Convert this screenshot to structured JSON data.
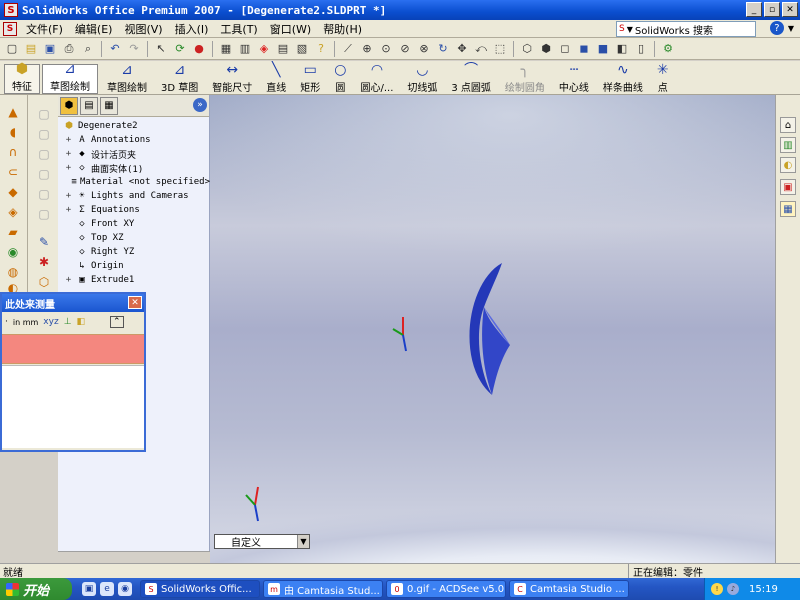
{
  "window": {
    "title": "SolidWorks Office Premium 2007 - [Degenerate2.SLDPRT *]",
    "app_icon_text": "S"
  },
  "menu": {
    "items": [
      {
        "label": "文件(F)",
        "disabled": false
      },
      {
        "label": "编辑(E)",
        "disabled": false
      },
      {
        "label": "视图(V)",
        "disabled": false
      },
      {
        "label": "插入(I)",
        "disabled": false
      },
      {
        "label": "工具(T)",
        "disabled": false
      },
      {
        "label": "窗口(W)",
        "disabled": false
      },
      {
        "label": "帮助(H)",
        "disabled": false
      }
    ],
    "search_label": "SolidWorks 搜索"
  },
  "commandmanager": {
    "tabs": [
      {
        "label": "特征",
        "icon": "feature-icon"
      },
      {
        "label": "草图绘制",
        "icon": "sketch-tab-icon"
      }
    ],
    "commands": [
      {
        "label": "草图绘制",
        "icon": "sketch-icon",
        "glyph": "⊿",
        "disabled": false
      },
      {
        "label": "3D 草图",
        "icon": "3d-sketch-icon",
        "glyph": "⊿",
        "disabled": false
      },
      {
        "label": "智能尺寸",
        "icon": "smart-dimension-icon",
        "glyph": "↔",
        "disabled": false
      },
      {
        "label": "直线",
        "icon": "line-icon",
        "glyph": "╲",
        "disabled": false
      },
      {
        "label": "矩形",
        "icon": "rectangle-icon",
        "glyph": "▭",
        "disabled": false
      },
      {
        "label": "圆",
        "icon": "circle-icon",
        "glyph": "○",
        "disabled": false
      },
      {
        "label": "圆心/...",
        "icon": "centerpoint-arc-icon",
        "glyph": "◠",
        "disabled": false
      },
      {
        "label": "切线弧",
        "icon": "tangent-arc-icon",
        "glyph": "◡",
        "disabled": false
      },
      {
        "label": "3 点圆弧",
        "icon": "3point-arc-icon",
        "glyph": "⌒",
        "disabled": false
      },
      {
        "label": "绘制圆角",
        "icon": "sketch-fillet-icon",
        "glyph": "╮",
        "disabled": true
      },
      {
        "label": "中心线",
        "icon": "centerline-icon",
        "glyph": "┄",
        "disabled": false
      },
      {
        "label": "样条曲线",
        "icon": "spline-icon",
        "glyph": "∿",
        "disabled": false
      },
      {
        "label": "点",
        "icon": "point-icon",
        "glyph": "✳",
        "disabled": false
      }
    ]
  },
  "feature_tree": {
    "root": "Degenerate2",
    "items": [
      {
        "label": "Annotations",
        "icon": "annotations-icon",
        "glyph": "A",
        "expandable": true
      },
      {
        "label": "设计活页夹",
        "icon": "design-binder-icon",
        "glyph": "◆",
        "expandable": true
      },
      {
        "label": "曲面实体(1)",
        "icon": "surface-bodies-icon",
        "glyph": "◇",
        "expandable": true
      },
      {
        "label": "Material <not specified>",
        "icon": "material-icon",
        "glyph": "≡",
        "expandable": false
      },
      {
        "label": "Lights and Cameras",
        "icon": "lights-icon",
        "glyph": "☀",
        "expandable": true
      },
      {
        "label": "Equations",
        "icon": "equations-icon",
        "glyph": "Σ",
        "expandable": true
      },
      {
        "label": "Front XY",
        "icon": "plane-icon",
        "glyph": "◇",
        "expandable": false
      },
      {
        "label": "Top XZ",
        "icon": "plane-icon",
        "glyph": "◇",
        "expandable": false
      },
      {
        "label": "Right YZ",
        "icon": "plane-icon",
        "glyph": "◇",
        "expandable": false
      },
      {
        "label": "Origin",
        "icon": "origin-icon",
        "glyph": "↳",
        "expandable": false
      },
      {
        "label": "Extrude1",
        "icon": "extrude-icon",
        "glyph": "▣",
        "expandable": true
      }
    ]
  },
  "measure": {
    "title": "此处来测量",
    "units_label": "in mm"
  },
  "viewport": {
    "view_dropdown": "自定义"
  },
  "status": {
    "left": "就绪",
    "right": "正在编辑：零件"
  },
  "taskbar": {
    "start": "开始",
    "tasks": [
      {
        "label": "SolidWorks Offic...",
        "icon": "S",
        "active": true
      },
      {
        "label": "由 Camtasia Stud...",
        "icon": "m",
        "active": false
      },
      {
        "label": "0.gif - ACDSee v5.0",
        "icon": "0",
        "active": false
      },
      {
        "label": "Camtasia Studio ...",
        "icon": "C",
        "active": false
      }
    ],
    "clock": "15:19"
  }
}
